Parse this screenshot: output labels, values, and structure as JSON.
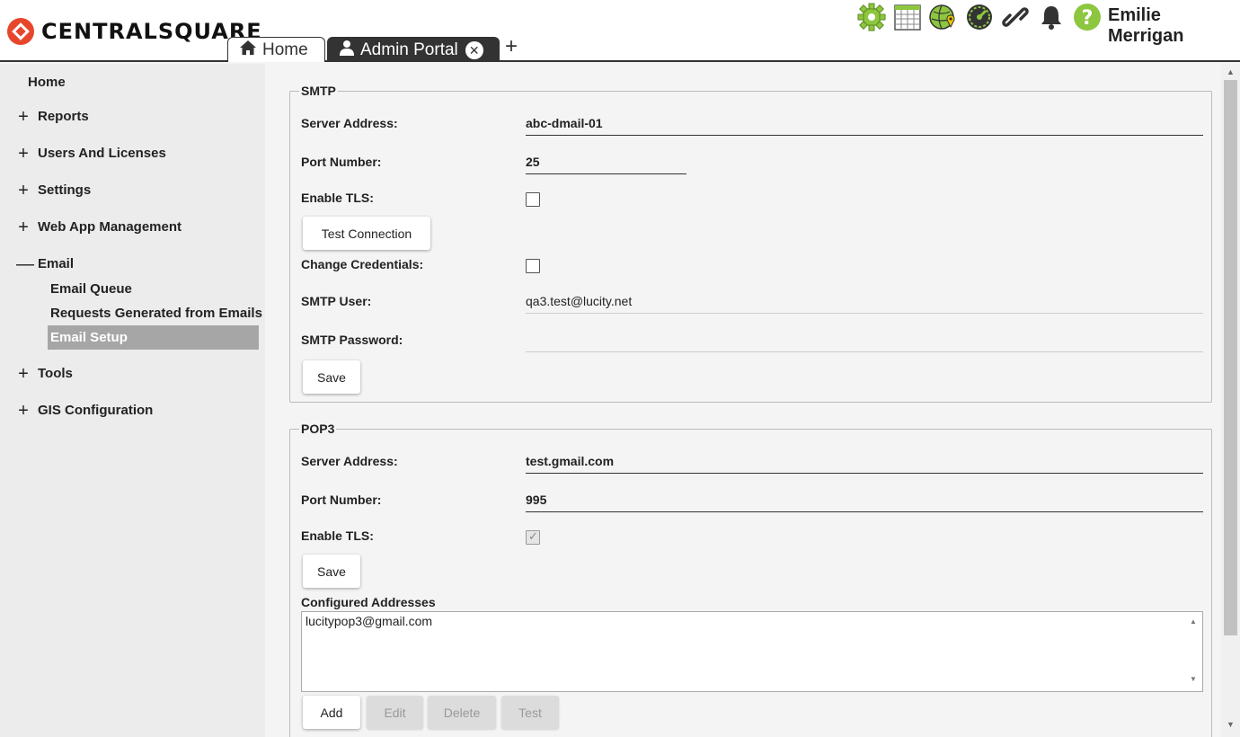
{
  "header": {
    "brand": "CENTRALSQUARE",
    "tabs": [
      {
        "label": "Home",
        "icon": "home-icon"
      },
      {
        "label": "Admin Portal",
        "icon": "user-icon"
      }
    ],
    "add_tab_symbol": "+",
    "close_symbol": "✕",
    "toolbar_icons": [
      "gear-icon",
      "calendar-icon",
      "map-pin-icon",
      "dashboard-icon",
      "link-icon",
      "bell-icon",
      "help-icon"
    ],
    "user_name": "Emilie Merrigan",
    "colors": {
      "accent": "#8dc63f",
      "brand": "#e8462b",
      "dark": "#333333"
    }
  },
  "sidebar": {
    "home": "Home",
    "items": [
      {
        "label": "Reports",
        "sign": "+"
      },
      {
        "label": "Users And Licenses",
        "sign": "+"
      },
      {
        "label": "Settings",
        "sign": "+"
      },
      {
        "label": "Web App Management",
        "sign": "+"
      },
      {
        "label": "Email",
        "sign": "—"
      },
      {
        "label": "Tools",
        "sign": "+"
      },
      {
        "label": "GIS Configuration",
        "sign": "+"
      }
    ],
    "email_subitems": [
      {
        "label": "Email Queue"
      },
      {
        "label": "Requests Generated from Emails"
      },
      {
        "label": "Email Setup"
      }
    ]
  },
  "smtp": {
    "legend": "SMTP",
    "server_address_label": "Server Address:",
    "server_address": "abc-dmail-01",
    "port_label": "Port Number:",
    "port": "25",
    "tls_label": "Enable TLS:",
    "tls_checked": false,
    "test_button": "Test Connection",
    "change_credentials_label": "Change Credentials:",
    "change_credentials_checked": false,
    "user_label": "SMTP User:",
    "user": "qa3.test@lucity.net",
    "password_label": "SMTP Password:",
    "password": "",
    "save_button": "Save"
  },
  "pop3": {
    "legend": "POP3",
    "server_address_label": "Server Address:",
    "server_address": "test.gmail.com",
    "port_label": "Port Number:",
    "port": "995",
    "tls_label": "Enable TLS:",
    "tls_checked": true,
    "save_button": "Save",
    "configured_label": "Configured Addresses",
    "addresses": [
      "lucitypop3@gmail.com"
    ],
    "add_button": "Add",
    "edit_button": "Edit",
    "delete_button": "Delete",
    "test_button": "Test"
  }
}
